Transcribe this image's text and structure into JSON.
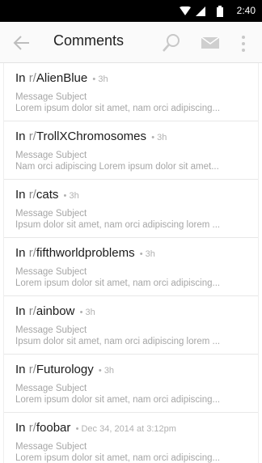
{
  "status_bar": {
    "time": "2:40",
    "icons": [
      "wifi-icon",
      "signal-icon",
      "battery-icon"
    ]
  },
  "app_bar": {
    "title": "Comments",
    "icons": [
      "back-arrow-icon",
      "search-icon",
      "mail-icon",
      "overflow-menu-icon"
    ]
  },
  "messages": [
    {
      "prefix": "In ",
      "rslash": "r/",
      "subreddit": "AlienBlue",
      "meta": "• 3h",
      "subject": "Message Subject",
      "body": "Lorem ipsum dolor sit amet, nam orci adipiscing..."
    },
    {
      "prefix": "In ",
      "rslash": "r/",
      "subreddit": "TrollXChromosomes",
      "meta": "• 3h",
      "subject": "Message Subject",
      "body": "Nam orci adipiscing Lorem ipsum dolor sit amet..."
    },
    {
      "prefix": "In ",
      "rslash": "r/",
      "subreddit": "cats",
      "meta": "• 3h",
      "subject": "Message Subject",
      "body": "Ipsum dolor sit amet, nam orci adipiscing lorem ..."
    },
    {
      "prefix": "In ",
      "rslash": "r/",
      "subreddit": "fifthworldproblems",
      "meta": "• 3h",
      "subject": "Message Subject",
      "body": "Lorem ipsum dolor sit amet, nam orci adipiscing..."
    },
    {
      "prefix": "In ",
      "rslash": "r/",
      "subreddit": "ainbow",
      "meta": "• 3h",
      "subject": "Message Subject",
      "body": "Ipsum dolor sit amet, nam orci adipiscing lorem ..."
    },
    {
      "prefix": "In ",
      "rslash": "r/",
      "subreddit": "Futurology",
      "meta": "• 3h",
      "subject": "Message Subject",
      "body": "Lorem ipsum dolor sit amet, nam orci adipiscing..."
    },
    {
      "prefix": "In ",
      "rslash": "r/",
      "subreddit": "foobar",
      "meta": "• Dec 34, 2014 at 3:12pm",
      "subject": "Message Subject",
      "body": "Lorem ipsum dolor sit amet, nam orci adipiscing..."
    }
  ],
  "colors": {
    "status_bar": "#000000",
    "app_bar": "#fafafa",
    "icon_gray": "#c8c8c8",
    "meta_text": "#b0b0b0"
  }
}
